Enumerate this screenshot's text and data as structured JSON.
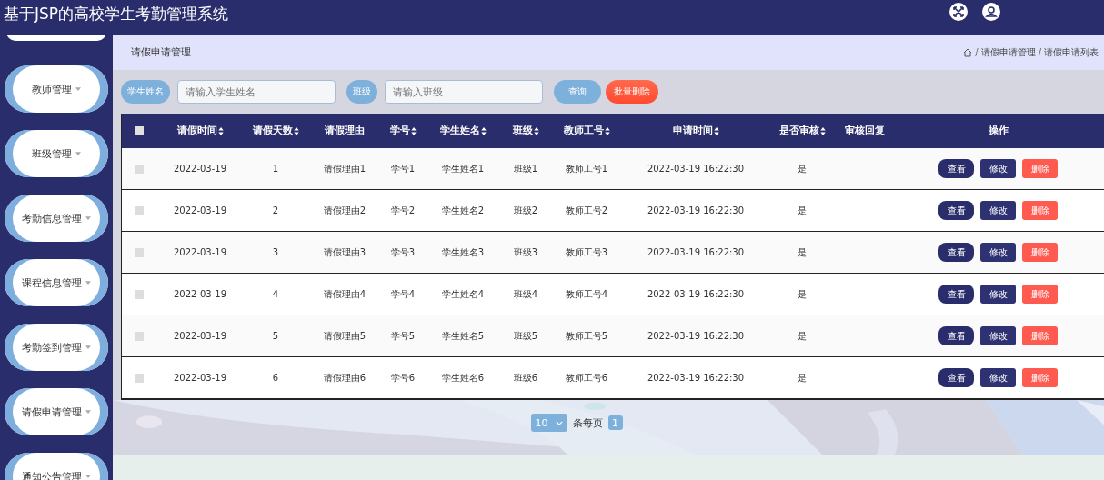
{
  "header": {
    "title": "基于JSP的高校学生考勤管理系统"
  },
  "sidebar": {
    "items": [
      {
        "label": "教师管理"
      },
      {
        "label": "班级管理"
      },
      {
        "label": "考勤信息管理"
      },
      {
        "label": "课程信息管理"
      },
      {
        "label": "考勤签到管理"
      },
      {
        "label": "请假申请管理"
      },
      {
        "label": "通知公告管理"
      }
    ]
  },
  "page": {
    "title": "请假申请管理",
    "breadcrumb": [
      "请假申请管理",
      "请假申请列表"
    ],
    "breadcrumb_separator": "/"
  },
  "search": {
    "fields": [
      {
        "label": "学生姓名",
        "placeholder": "请输入学生姓名"
      },
      {
        "label": "班级",
        "placeholder": "请输入班级"
      }
    ],
    "query_button": "查询",
    "batch_delete_button": "批量删除"
  },
  "table": {
    "columns": [
      {
        "label": "请假时间",
        "sortable": true
      },
      {
        "label": "请假天数",
        "sortable": true
      },
      {
        "label": "请假理由",
        "sortable": false
      },
      {
        "label": "学号",
        "sortable": true
      },
      {
        "label": "学生姓名",
        "sortable": true
      },
      {
        "label": "班级",
        "sortable": true
      },
      {
        "label": "教师工号",
        "sortable": true
      },
      {
        "label": "申请时间",
        "sortable": true
      },
      {
        "label": "是否审核",
        "sortable": true
      },
      {
        "label": "审核回复",
        "sortable": false
      },
      {
        "label": "操作",
        "sortable": false
      }
    ],
    "header_checked": false,
    "rows": [
      {
        "checked": false,
        "cells": [
          "2022-03-19",
          "1",
          "请假理由1",
          "学号1",
          "学生姓名1",
          "班级1",
          "教师工号1",
          "2022-03-19 16:22:30",
          "是"
        ],
        "actions": [
          "查看",
          "修改",
          "删除"
        ]
      },
      {
        "checked": false,
        "cells": [
          "2022-03-19",
          "2",
          "请假理由2",
          "学号2",
          "学生姓名2",
          "班级2",
          "教师工号2",
          "2022-03-19 16:22:30",
          "是"
        ],
        "actions": [
          "查看",
          "修改",
          "删除"
        ]
      },
      {
        "checked": false,
        "cells": [
          "2022-03-19",
          "3",
          "请假理由3",
          "学号3",
          "学生姓名3",
          "班级3",
          "教师工号3",
          "2022-03-19 16:22:30",
          "是"
        ],
        "actions": [
          "查看",
          "修改",
          "删除"
        ]
      },
      {
        "checked": false,
        "cells": [
          "2022-03-19",
          "4",
          "请假理由4",
          "学号4",
          "学生姓名4",
          "班级4",
          "教师工号4",
          "2022-03-19 16:22:30",
          "是"
        ],
        "actions": [
          "查看",
          "修改",
          "删除"
        ]
      },
      {
        "checked": false,
        "cells": [
          "2022-03-19",
          "5",
          "请假理由5",
          "学号5",
          "学生姓名5",
          "班级5",
          "教师工号5",
          "2022-03-19 16:22:30",
          "是"
        ],
        "actions": [
          "查看",
          "修改",
          "删除"
        ]
      },
      {
        "checked": false,
        "cells": [
          "2022-03-19",
          "6",
          "请假理由6",
          "学号6",
          "学生姓名6",
          "班级6",
          "教师工号6",
          "2022-03-19 16:22:30",
          "是"
        ],
        "actions": [
          "查看",
          "修改",
          "删除"
        ]
      }
    ]
  },
  "pagination": {
    "page_size": "10",
    "page_size_label": "条每页",
    "pages": [
      {
        "label": "1",
        "selected": true
      }
    ]
  }
}
